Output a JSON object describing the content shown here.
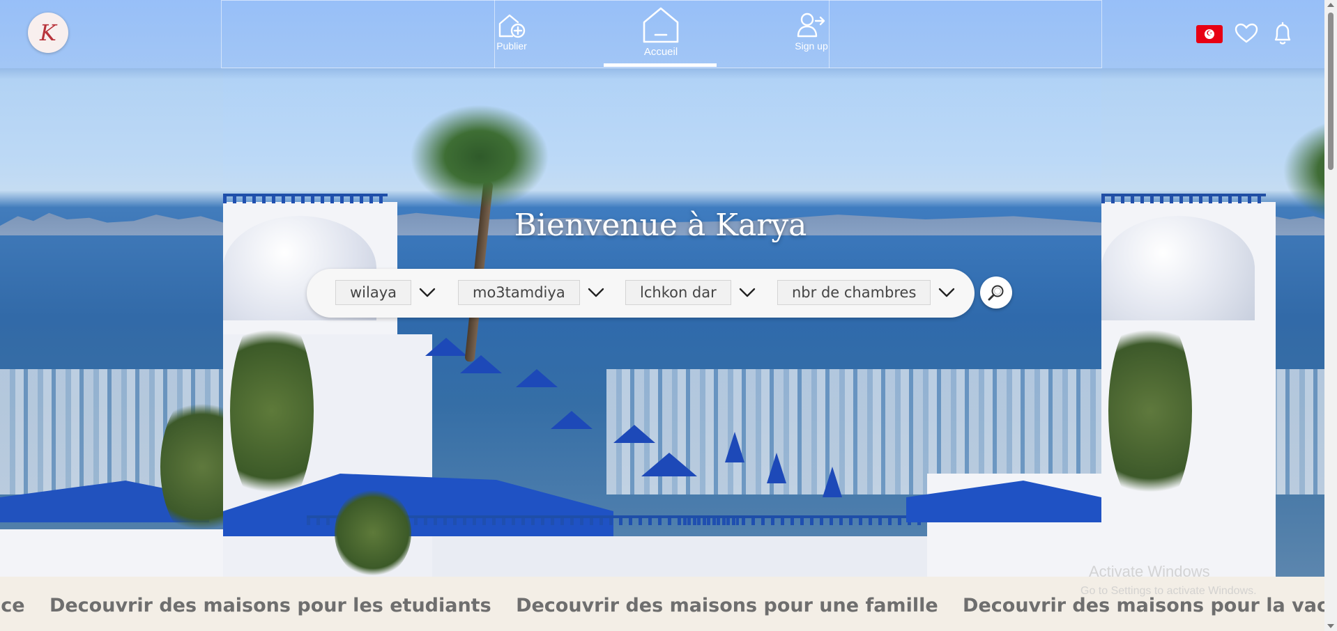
{
  "header": {
    "logo_letter": "K",
    "nav": {
      "publish_label": "Publier",
      "home_label": "Accueil",
      "signup_label": "Sign up"
    },
    "flag_country": "Tunisia",
    "icons": [
      "plus-house-icon",
      "home-icon",
      "user-arrow-icon",
      "heart-icon",
      "bell-icon"
    ]
  },
  "hero": {
    "title": "Bienvenue à Karya"
  },
  "search": {
    "filters": [
      {
        "label": "wilaya"
      },
      {
        "label": "mo3tamdiya"
      },
      {
        "label": "lchkon dar"
      },
      {
        "label": "nbr de chambres"
      }
    ]
  },
  "marquee": {
    "items": [
      "nce",
      "Decouvrir des maisons pour les etudiants",
      "Decouvrir des maisons pour une famille",
      "Decouvrir des maisons pour la vacance"
    ]
  },
  "watermark": {
    "line1": "Activate Windows",
    "line2": "Go to Settings to activate Windows."
  },
  "colors": {
    "header_bg": "#96bef8",
    "flag_red": "#e70013",
    "marquee_bg": "#f3eee6",
    "marquee_text": "#6e6e6e"
  }
}
